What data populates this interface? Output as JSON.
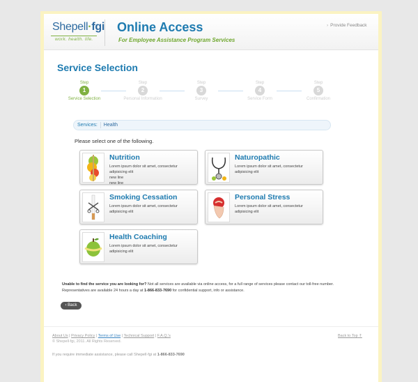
{
  "header": {
    "logo_left": "Shepell",
    "logo_dot": "·",
    "logo_right": "fgi",
    "logo_tagline": "work. health. life.",
    "app_title": "Online Access",
    "app_subtitle": "For Employee Assistance Program Services",
    "feedback_link": "Provide Feedback"
  },
  "page_title": "Service Selection",
  "stepper": [
    {
      "top": "Step",
      "number": "1",
      "label": "Service Selection",
      "active": true
    },
    {
      "top": "Step",
      "number": "2",
      "label": "Personal Information",
      "active": false
    },
    {
      "top": "Step",
      "number": "3",
      "label": "Survey",
      "active": false
    },
    {
      "top": "Step",
      "number": "4",
      "label": "Service Form",
      "active": false
    },
    {
      "top": "Step",
      "number": "5",
      "label": "Confirmation",
      "active": false
    }
  ],
  "breadcrumb": {
    "label": "Services:",
    "value": "Health"
  },
  "prompt": "Please select one of the following.",
  "cards": [
    {
      "title": "Nutrition",
      "desc": "Lorem ipsum dolor sit amet, consectetur adipisicing elit",
      "extra1": "new line",
      "extra2": "new line",
      "icon": "fruit-icon"
    },
    {
      "title": "Naturopathic",
      "desc": "Lorem ipsum dolor sit amet, consectetur adipisicing elit",
      "icon": "stethoscope-icon"
    },
    {
      "title": "Smoking Cessation",
      "desc": "Lorem ipsum dolor sit amet, consectetur adipisicing elit",
      "icon": "cigarette-icon"
    },
    {
      "title": "Personal Stress",
      "desc": "Lorem ipsum dolor sit amet, consectetur adipisicing elit",
      "icon": "stress-ball-icon"
    },
    {
      "title": "Health Coaching",
      "desc": "Lorem ipsum dolor sit amet, consectetur adipisicing elit",
      "icon": "apple-tape-icon"
    }
  ],
  "bottom": {
    "question": "Unable to find the service you are looking for?",
    "line1_rest": " Not all services are available via online access, for a full range of services please contact our toll-free number.",
    "line2_a": "Representatives are available 24 hours a day at ",
    "phone": "1-866-833-7690",
    "line2_b": " for confidential support, info or assistance."
  },
  "back_button": "‹ Back",
  "footer": {
    "links": [
      "About Us",
      "Privacy Policy",
      "Terms of Use",
      "Technical Support",
      "F.A.Q.'s"
    ],
    "separator": " | ",
    "copyright": "© Shepell·fgi, 2011. All Rights Reserved.",
    "back_to_top": "Back to Top",
    "assist_a": "If you require immediate assistance, please call Shepell·fgi at ",
    "assist_phone": "1-866-833-7690"
  },
  "colors": {
    "accent_blue": "#1e7bb0",
    "accent_green": "#7fb141",
    "frame_yellow": "#fbf3c2"
  }
}
